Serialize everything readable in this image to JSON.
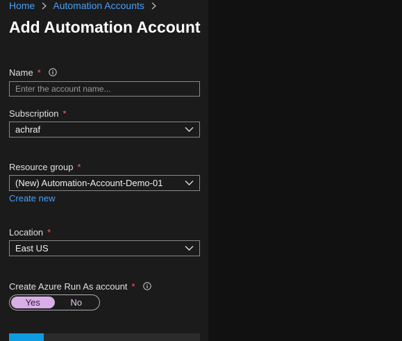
{
  "breadcrumb": {
    "items": [
      "Home",
      "Automation Accounts"
    ]
  },
  "page": {
    "title": "Add Automation Account"
  },
  "form": {
    "name": {
      "label": "Name",
      "required_mark": "*",
      "placeholder": "Enter the account name...",
      "value": ""
    },
    "subscription": {
      "label": "Subscription",
      "required_mark": "*",
      "value": "achraf"
    },
    "resource_group": {
      "label": "Resource group",
      "required_mark": "*",
      "value": "(New) Automation-Account-Demo-01",
      "create_new_label": "Create new"
    },
    "location": {
      "label": "Location",
      "required_mark": "*",
      "value": "East US"
    },
    "run_as": {
      "label": "Create Azure Run As account",
      "required_mark": "*",
      "options": [
        "Yes",
        "No"
      ],
      "selected": "Yes"
    }
  },
  "colors": {
    "accent_link": "#4aa0f5",
    "required": "#ff5e5e",
    "toggle_selected": "#d9aee8",
    "primary_button": "#0f9be0"
  },
  "icons": {
    "breadcrumb_separator": "chevron-right-icon",
    "info": "info-icon",
    "dropdown": "chevron-down-icon"
  }
}
